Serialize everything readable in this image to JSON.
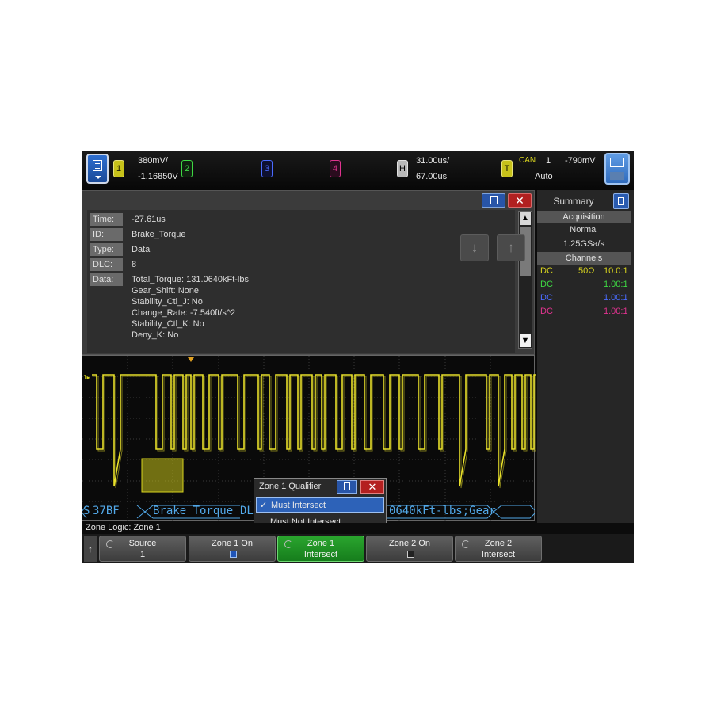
{
  "topbar": {
    "ch1": {
      "label": "1",
      "scale": "380mV/",
      "offset": "-1.16850V"
    },
    "ch2": {
      "label": "2"
    },
    "ch3": {
      "label": "3"
    },
    "ch4": {
      "label": "4"
    },
    "horizontal": {
      "label": "H",
      "timebase": "31.00us/",
      "delay": "67.00us"
    },
    "trigger": {
      "label": "T",
      "protocol": "CAN",
      "channel": "1",
      "level": "-790mV",
      "mode": "Auto"
    },
    "colors": {
      "ch1": "#d9d51e",
      "ch2": "#3ed843",
      "ch3": "#4a6bff",
      "ch4": "#e0338f"
    }
  },
  "list": {
    "fields": [
      {
        "label": "Time:",
        "value": "-27.61us"
      },
      {
        "label": "ID:",
        "value": "Brake_Torque"
      },
      {
        "label": "Type:",
        "value": "Data"
      },
      {
        "label": "DLC:",
        "value": "8"
      },
      {
        "label": "Data:",
        "value": ""
      }
    ],
    "data_lines": [
      "Total_Torque: 131.0640kFt-lbs",
      "Gear_Shift: None",
      "Stability_Ctl_J: No",
      "Change_Rate: -7.540ft/s^2",
      "Stability_Ctl_K: No",
      "Deny_K: No"
    ],
    "close_icon": "✕",
    "nav_down_icon": "↓",
    "nav_up_icon": "↑"
  },
  "side": {
    "title": "Summary",
    "acquisition_header": "Acquisition",
    "mode": "Normal",
    "sample_rate": "1.25GSa/s",
    "channels_header": "Channels",
    "channels": [
      {
        "coupling": "DC",
        "impedance": "50Ω",
        "probe": "10.0:1",
        "color": "#d9d51e"
      },
      {
        "coupling": "DC",
        "impedance": "",
        "probe": "1.00:1",
        "color": "#3ed843"
      },
      {
        "coupling": "DC",
        "impedance": "",
        "probe": "1.00:1",
        "color": "#4a6bff"
      },
      {
        "coupling": "DC",
        "impedance": "",
        "probe": "1.00:1",
        "color": "#e0338f"
      }
    ]
  },
  "decode": {
    "prefix": "S",
    "frame_id": "37BF",
    "name": "Brake_Torque",
    "dl": "DL",
    "tail": "0640kFt-lbs;Gear"
  },
  "popup": {
    "title": "Zone 1 Qualifier",
    "options": [
      "Must Intersect",
      "Must Not Intersect"
    ],
    "selected_mark": "✓",
    "close_icon": "✕"
  },
  "bottom": {
    "zone_logic": "Zone Logic: Zone 1",
    "back_icon": "↑",
    "softkeys": [
      {
        "line1": "Source",
        "line2": "1"
      },
      {
        "line1": "Zone 1 On",
        "line2": ""
      },
      {
        "line1": "Zone 1",
        "line2": "Intersect"
      },
      {
        "line1": "Zone 2 On",
        "line2": ""
      },
      {
        "line1": "Zone 2",
        "line2": "Intersect"
      }
    ]
  }
}
